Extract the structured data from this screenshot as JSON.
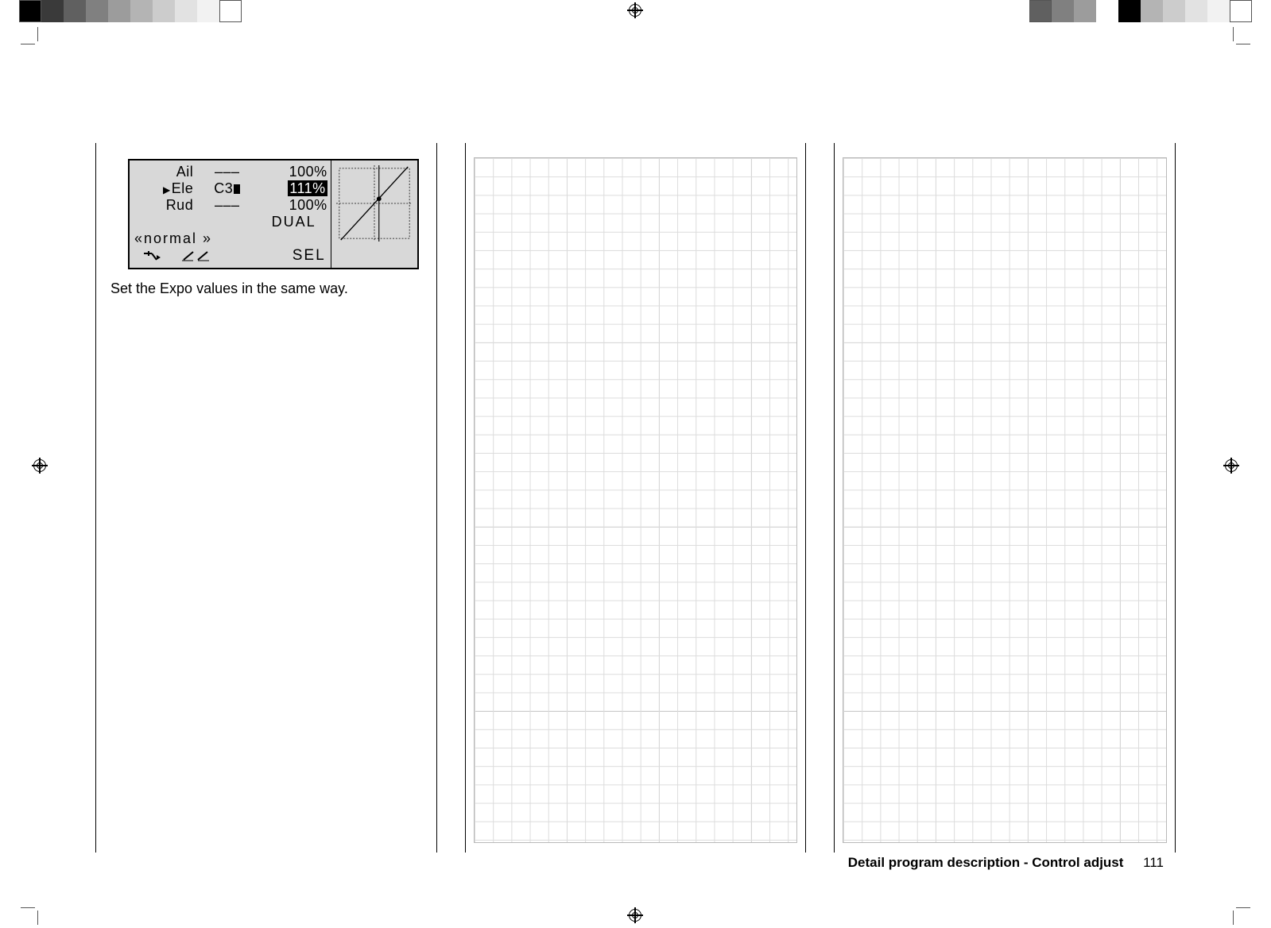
{
  "lcd": {
    "rows": [
      {
        "ch": "Ail",
        "sw": "–––",
        "val": "100%"
      },
      {
        "ch": "Ele",
        "sw": "C3",
        "val": "111%",
        "selected": true
      },
      {
        "ch": "Rud",
        "sw": "–––",
        "val": "100%"
      }
    ],
    "mode_label": "DUAL",
    "phase_label": "«normal »",
    "sel_label": "SEL"
  },
  "caption": "Set the Expo values in the same way.",
  "footer": {
    "title": "Detail program description - Control adjust",
    "page": "111"
  },
  "top_swatches": {
    "left": [
      "#000000",
      "#3a3a3a",
      "#606060",
      "#808080",
      "#9c9c9c",
      "#b4b4b4",
      "#cccccc",
      "#e2e2e2",
      "#f2f2f2",
      "#ffffff"
    ],
    "right": [
      "#ffffff",
      "#f2f2f2",
      "#e2e2e2",
      "#cccccc",
      "#b4b4b4",
      "#000000",
      "#ffffff",
      "#9c9c9c",
      "#808080",
      "#606060"
    ]
  }
}
